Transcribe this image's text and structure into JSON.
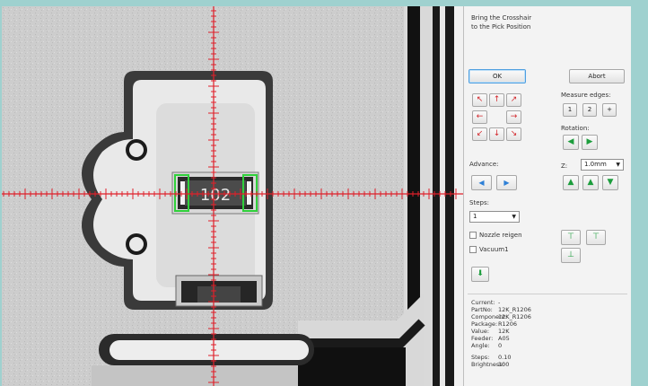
{
  "prompt": {
    "line1": "Bring the Crosshair",
    "line2": "to the Pick Position"
  },
  "buttons": {
    "ok": "OK",
    "abort": "Abort"
  },
  "measure_edges": {
    "label": "Measure edges:",
    "btn1": "1",
    "btn2": "2",
    "btn_plus": "+"
  },
  "rotation": {
    "label": "Rotation:"
  },
  "advance": {
    "label": "Advance:"
  },
  "z": {
    "label": "Z:",
    "value": "1.0mm"
  },
  "steps": {
    "label": "Steps:",
    "value": "1"
  },
  "checks": {
    "nozzle": "Nozzle reigen",
    "vacuum": "Vacuum1"
  },
  "component_label": "102",
  "info": {
    "rows": [
      {
        "k": "Current:",
        "v": "-"
      },
      {
        "k": "PartNo:",
        "v": "12K_R1206"
      },
      {
        "k": "Component:",
        "v": "12K_R1206"
      },
      {
        "k": "Package:",
        "v": "R1206"
      },
      {
        "k": "Value:",
        "v": "12K"
      },
      {
        "k": "Feeder:",
        "v": "A05"
      },
      {
        "k": "Angle:",
        "v": "0"
      }
    ],
    "steps_k": "Steps:",
    "steps_v": "0.10",
    "brightness_k": "Brightness:",
    "brightness_v": "100"
  },
  "colors": {
    "crosshair": "#e0202a",
    "detect": "#2fd03a",
    "panel": "#f3f3f3",
    "frame": "#9fd1cf"
  }
}
